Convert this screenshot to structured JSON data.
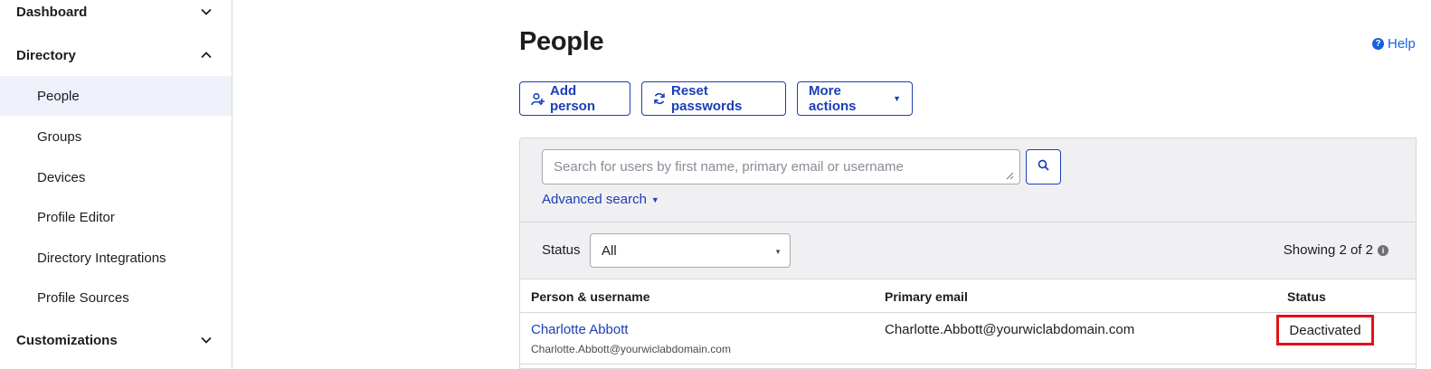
{
  "sidebar": {
    "sections": [
      {
        "label": "Dashboard",
        "chevron": "chevron-down-icon"
      },
      {
        "label": "Directory",
        "chevron": "chevron-up-icon"
      },
      {
        "label": "Customizations",
        "chevron": "chevron-down-icon"
      }
    ],
    "directory_items": [
      {
        "label": "People",
        "active": true
      },
      {
        "label": "Groups"
      },
      {
        "label": "Devices"
      },
      {
        "label": "Profile Editor"
      },
      {
        "label": "Directory Integrations"
      },
      {
        "label": "Profile Sources"
      }
    ]
  },
  "header": {
    "title": "People",
    "help_label": "Help",
    "help_icon": "question-circle-icon"
  },
  "toolbar": {
    "add_person": "Add person",
    "add_person_icon": "add-user-icon",
    "reset_passwords": "Reset passwords",
    "reset_icon": "refresh-icon",
    "more_actions": "More actions",
    "more_caret": "▼"
  },
  "search": {
    "placeholder": "Search for users by first name, primary email or username",
    "value": "",
    "search_icon": "search-icon",
    "advanced_label": "Advanced search",
    "advanced_caret": "▼"
  },
  "filter": {
    "status_label": "Status",
    "status_value": "All",
    "select_caret": "▼",
    "showing_text": "Showing 2 of 2",
    "info_icon": "info-icon"
  },
  "table": {
    "columns": [
      "Person & username",
      "Primary email",
      "Status"
    ],
    "rows": [
      {
        "name": "Charlotte Abbott",
        "username": "Charlotte.Abbott@yourwiclabdomain.com",
        "email": "Charlotte.Abbott@yourwiclabdomain.com",
        "status": "Deactivated"
      }
    ]
  },
  "colors": {
    "link": "#1a3fb5",
    "active_bg": "#eef0fa",
    "highlight": "#e3111a"
  }
}
